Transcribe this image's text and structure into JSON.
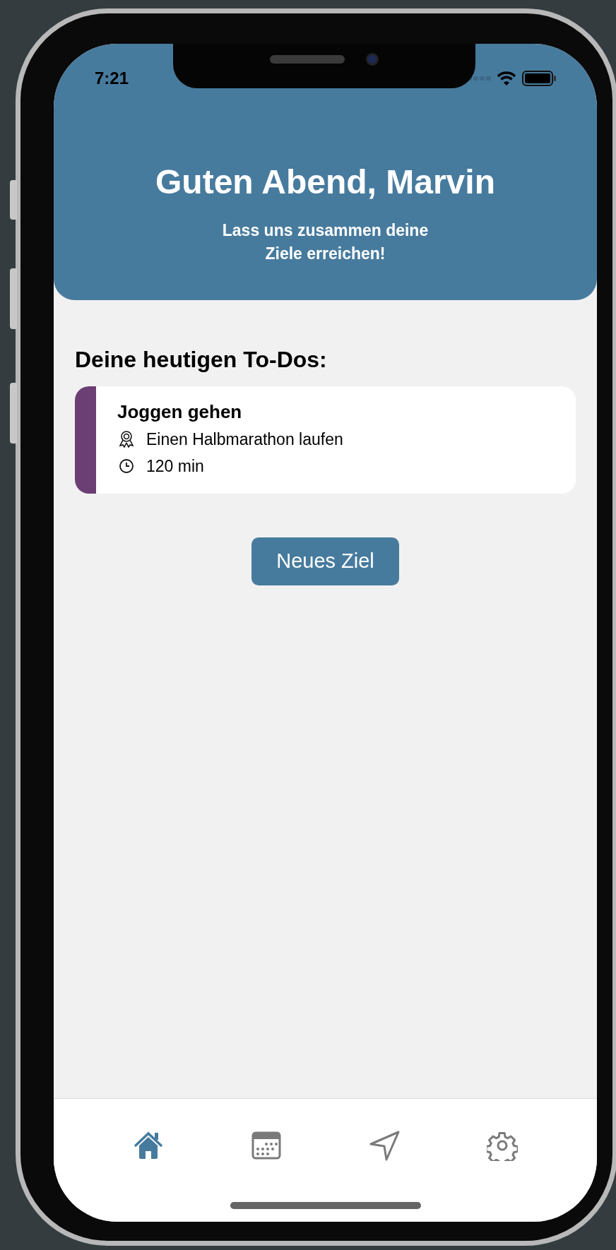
{
  "status_bar": {
    "time": "7:21"
  },
  "header": {
    "title": "Guten Abend, Marvin",
    "subtitle": "Lass uns zusammen deine\nZiele erreichen!"
  },
  "todos": {
    "heading": "Deine heutigen To-Dos:",
    "items": [
      {
        "title": "Joggen gehen",
        "goal": "Einen Halbmarathon laufen",
        "duration": "120 min",
        "color": "#6b3f73"
      }
    ]
  },
  "new_goal_button": "Neues Ziel",
  "tab_bar": [
    {
      "kind": "home",
      "selected": true
    },
    {
      "kind": "calendar",
      "selected": false
    },
    {
      "kind": "navigation",
      "selected": false
    },
    {
      "kind": "settings",
      "selected": false
    }
  ]
}
